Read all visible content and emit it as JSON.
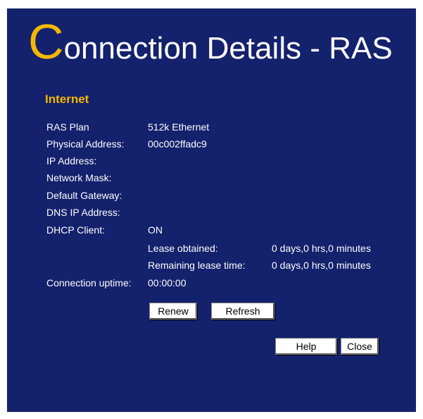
{
  "header": {
    "title_initial": "C",
    "title_rest": "onnection Details - RAS"
  },
  "section": {
    "heading": "Internet"
  },
  "details": {
    "ras_plan_label": "RAS Plan",
    "ras_plan_value": "512k Ethernet",
    "physical_address_label": "Physical Address:",
    "physical_address_value": "00c002ffadc9",
    "ip_address_label": "IP Address:",
    "ip_address_value": "",
    "network_mask_label": "Network Mask:",
    "network_mask_value": "",
    "default_gateway_label": "Default Gateway:",
    "default_gateway_value": "",
    "dns_ip_label": "DNS IP Address:",
    "dns_ip_value": "",
    "dhcp_client_label": "DHCP Client:",
    "dhcp_client_value": "ON",
    "lease_obtained_label": "Lease obtained:",
    "lease_obtained_value": "0 days,0 hrs,0 minutes",
    "remaining_lease_label": "Remaining lease time:",
    "remaining_lease_value": "0 days,0 hrs,0 minutes",
    "uptime_label": "Connection uptime:",
    "uptime_value": "00:00:00"
  },
  "buttons": {
    "renew": "Renew",
    "refresh": "Refresh",
    "help": "Help",
    "close": "Close"
  },
  "colors": {
    "background": "#14216c",
    "accent": "#f5b800",
    "text": "#ffffff"
  }
}
